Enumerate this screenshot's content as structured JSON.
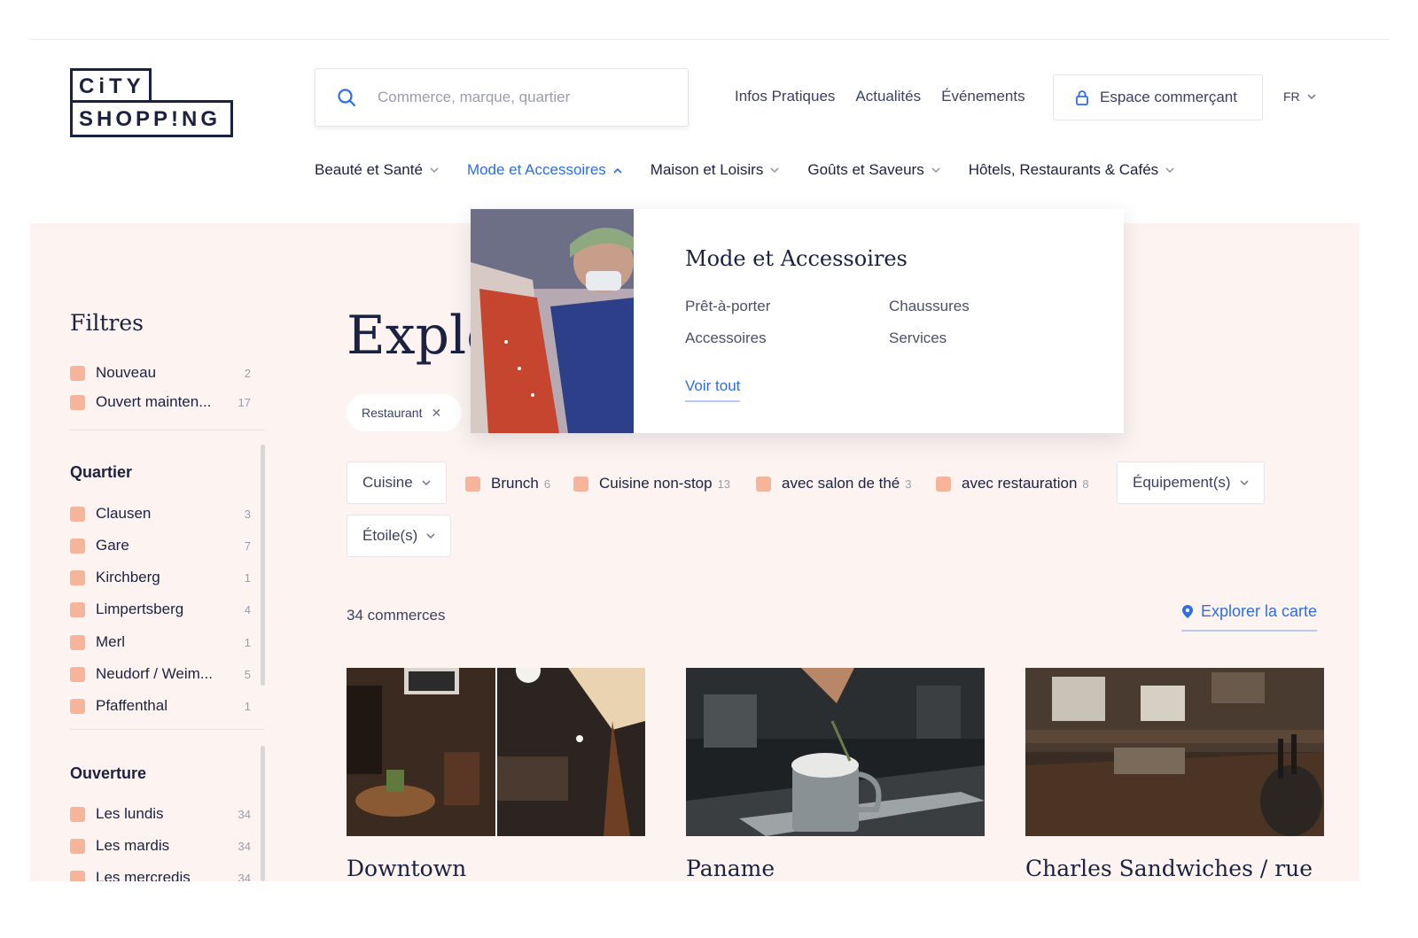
{
  "brand": {
    "logo_line1": "CiTY",
    "logo_line2": "SHOPP!NG"
  },
  "search": {
    "placeholder": "Commerce, marque, quartier"
  },
  "top_nav": [
    "Infos Pratiques",
    "Actualités",
    "Événements"
  ],
  "espace_button": "Espace commerçant",
  "language": "FR",
  "categories": [
    {
      "label": "Beauté et Santé",
      "active": false
    },
    {
      "label": "Mode et Accessoires",
      "active": true
    },
    {
      "label": "Maison et Loisirs",
      "active": false
    },
    {
      "label": "Goûts et Saveurs",
      "active": false
    },
    {
      "label": "Hôtels, Restaurants & Cafés",
      "active": false
    }
  ],
  "dropdown": {
    "title": "Mode et Accessoires",
    "links": [
      "Prêt-à-porter",
      "Chaussures",
      "Accessoires",
      "Services"
    ],
    "see_all": "Voir tout"
  },
  "filters": {
    "title": "Filtres",
    "general": [
      {
        "label": "Nouveau",
        "count": "2"
      },
      {
        "label": "Ouvert mainten...",
        "count": "17"
      }
    ],
    "quartier_title": "Quartier",
    "quartier": [
      {
        "label": "Clausen",
        "count": "3"
      },
      {
        "label": "Gare",
        "count": "7"
      },
      {
        "label": "Kirchberg",
        "count": "1"
      },
      {
        "label": "Limpertsberg",
        "count": "4"
      },
      {
        "label": "Merl",
        "count": "1"
      },
      {
        "label": "Neudorf / Weim...",
        "count": "5"
      },
      {
        "label": "Pfaffenthal",
        "count": "1"
      }
    ],
    "ouverture_title": "Ouverture",
    "ouverture": [
      {
        "label": "Les lundis",
        "count": "34"
      },
      {
        "label": "Les mardis",
        "count": "34"
      },
      {
        "label": "Les mercredis",
        "count": "34"
      }
    ]
  },
  "page_title": "Explo",
  "active_tag": "Restaurant",
  "refine": {
    "cuisine": "Cuisine",
    "checks": [
      {
        "label": "Brunch",
        "count": "6"
      },
      {
        "label": "Cuisine non-stop",
        "count": "13"
      },
      {
        "label": "avec salon de thé",
        "count": "3"
      },
      {
        "label": "avec restauration",
        "count": "8"
      }
    ],
    "equipements": "Équipement(s)",
    "etoiles": "Étoile(s)"
  },
  "results_count": "34 commerces",
  "map_link": "Explorer la carte",
  "cards": [
    {
      "name": "Downtown"
    },
    {
      "name": "Paname"
    },
    {
      "name": "Charles Sandwiches / rue"
    }
  ],
  "colors": {
    "accent": "#2d6ee6",
    "navy": "#1b2240",
    "checkbox": "#f6b59a",
    "background": "#fdf4f1"
  }
}
